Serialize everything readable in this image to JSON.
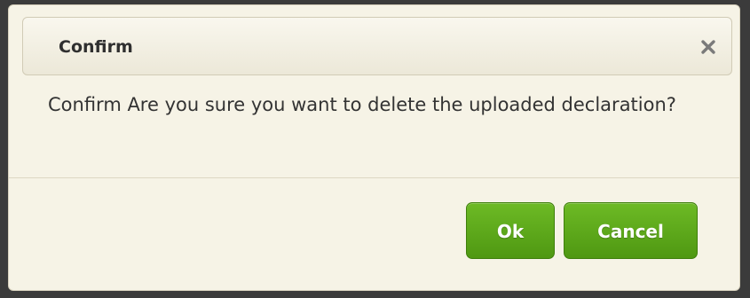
{
  "dialog": {
    "title": "Confirm",
    "message": "Confirm Are you sure you want to delete the uploaded declaration?",
    "buttons": {
      "ok_label": "Ok",
      "cancel_label": "Cancel"
    },
    "close_icon": "close-icon"
  },
  "colors": {
    "button_green": "#5aa81a",
    "dialog_background": "#f6f3e6",
    "overlay": "#3b3b3b"
  }
}
